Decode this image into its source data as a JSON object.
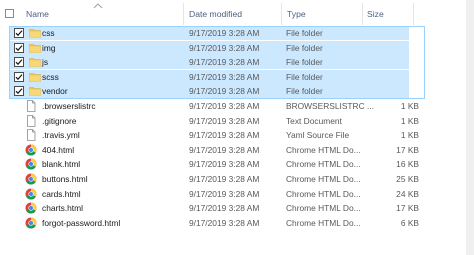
{
  "columns": {
    "name": "Name",
    "date": "Date modified",
    "type": "Type",
    "size": "Size"
  },
  "files": [
    {
      "name": "css",
      "date": "9/17/2019 3:28 AM",
      "type": "File folder",
      "size": "",
      "icon": "folder-icon",
      "selected": true
    },
    {
      "name": "img",
      "date": "9/17/2019 3:28 AM",
      "type": "File folder",
      "size": "",
      "icon": "folder-icon",
      "selected": true
    },
    {
      "name": "js",
      "date": "9/17/2019 3:28 AM",
      "type": "File folder",
      "size": "",
      "icon": "folder-icon",
      "selected": true
    },
    {
      "name": "scss",
      "date": "9/17/2019 3:28 AM",
      "type": "File folder",
      "size": "",
      "icon": "folder-icon",
      "selected": true
    },
    {
      "name": "vendor",
      "date": "9/17/2019 3:28 AM",
      "type": "File folder",
      "size": "",
      "icon": "folder-icon",
      "selected": true
    },
    {
      "name": ".browserslistrc",
      "date": "9/17/2019 3:28 AM",
      "type": "BROWSERSLISTRC ...",
      "size": "1 KB",
      "icon": "document-icon",
      "selected": false
    },
    {
      "name": ".gitignore",
      "date": "9/17/2019 3:28 AM",
      "type": "Text Document",
      "size": "1 KB",
      "icon": "document-icon",
      "selected": false
    },
    {
      "name": ".travis.yml",
      "date": "9/17/2019 3:28 AM",
      "type": "Yaml Source File",
      "size": "1 KB",
      "icon": "document-icon",
      "selected": false
    },
    {
      "name": "404.html",
      "date": "9/17/2019 3:28 AM",
      "type": "Chrome HTML Do...",
      "size": "17 KB",
      "icon": "chrome-icon",
      "selected": false
    },
    {
      "name": "blank.html",
      "date": "9/17/2019 3:28 AM",
      "type": "Chrome HTML Do...",
      "size": "16 KB",
      "icon": "chrome-icon",
      "selected": false
    },
    {
      "name": "buttons.html",
      "date": "9/17/2019 3:28 AM",
      "type": "Chrome HTML Do...",
      "size": "25 KB",
      "icon": "chrome-icon",
      "selected": false
    },
    {
      "name": "cards.html",
      "date": "9/17/2019 3:28 AM",
      "type": "Chrome HTML Do...",
      "size": "24 KB",
      "icon": "chrome-icon",
      "selected": false
    },
    {
      "name": "charts.html",
      "date": "9/17/2019 3:28 AM",
      "type": "Chrome HTML Do...",
      "size": "17 KB",
      "icon": "chrome-icon",
      "selected": false
    },
    {
      "name": "forgot-password.html",
      "date": "9/17/2019 3:28 AM",
      "type": "Chrome HTML Do...",
      "size": "6 KB",
      "icon": "chrome-icon",
      "selected": false
    }
  ],
  "colors": {
    "selection": "#cce8ff",
    "selection_border": "#99d1ff",
    "folder": "#f4c64d",
    "header_text": "#4d6082"
  }
}
